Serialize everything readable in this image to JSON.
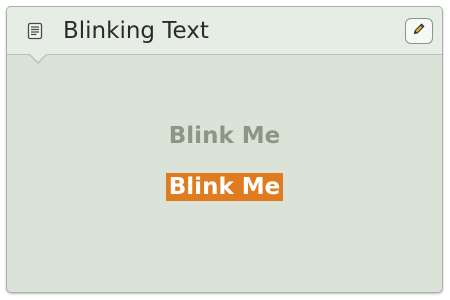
{
  "widget": {
    "title": "Blinking Text",
    "icons": {
      "header_icon": "document-icon",
      "edit_icon": "pencil-icon"
    },
    "content": {
      "text_dim": "Blink Me",
      "text_highlight": "Blink Me"
    },
    "colors": {
      "card_bg": "#dbe3d9",
      "header_bg": "#e6ede4",
      "dim_text": "#8a9686",
      "highlight_bg": "#e07b1f",
      "highlight_text": "#ffffff"
    }
  }
}
